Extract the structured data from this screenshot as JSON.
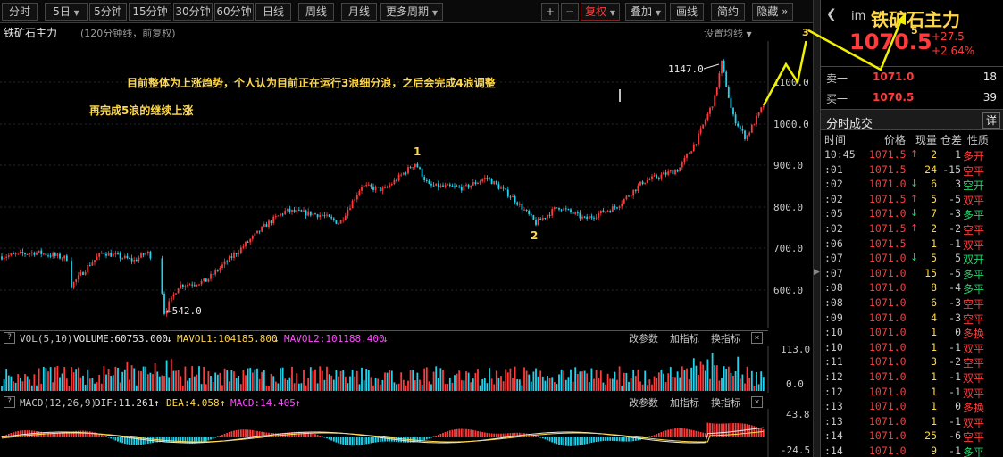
{
  "toolbar": {
    "left_buttons": [
      "分时",
      "5日",
      "5分钟",
      "15分钟",
      "30分钟",
      "60分钟",
      "日线",
      "周线",
      "月线",
      "更多周期"
    ],
    "right_buttons": [
      "+",
      "−",
      "复权",
      "叠加",
      "画线",
      "简约",
      "隐藏"
    ],
    "double_arrow": "»"
  },
  "chart": {
    "title": "铁矿石主力",
    "subtitle": "(120分钟线，前复权)",
    "ma_setting": "设置均线",
    "y_axis_labels": [
      "1100.0",
      "1000.0",
      "900.0",
      "800.0",
      "700.0",
      "600.0"
    ],
    "annotation_line1": "目前整体为上涨趋势，个人认为目前正在运行3浪细分浪，之后会完成4浪调整",
    "annotation_line2": "再完成5浪的继续上涨",
    "high_label": "1147.0",
    "low_label": "←542.0",
    "wave_labels": [
      "1",
      "2",
      "3",
      "5"
    ],
    "colors": {
      "up": "#ff3b3b",
      "down": "#22d3ee",
      "annotation": "#ffd84a",
      "wave_line": "#f0f000"
    }
  },
  "volume_panel": {
    "title": "VOL(5,10)",
    "volume": "VOLUME:60753.000",
    "mavol1": "MAVOL1:104185.800",
    "mavol2": "MAVOL2:101188.400",
    "y_labels": [
      "113.0",
      "0.0"
    ],
    "buttons": [
      "改参数",
      "加指标",
      "换指标"
    ]
  },
  "macd_panel": {
    "title": "MACD(12,26,9)",
    "dif": "DIF:11.261",
    "dea": "DEA:4.058",
    "macd": "MACD:14.405",
    "y_labels": [
      "43.8",
      "-24.5"
    ],
    "buttons": [
      "改参数",
      "加指标",
      "换指标"
    ]
  },
  "quote": {
    "back_icon": "chevron-left-icon",
    "code": "im",
    "name": "铁矿石主力",
    "price": "1070.5",
    "change": "+27.5",
    "change_pct": "+2.64%",
    "sell_label": "卖一",
    "sell_price": "1071.0",
    "sell_qty": "18",
    "buy_label": "买一",
    "buy_price": "1070.5",
    "buy_qty": "39"
  },
  "timesales": {
    "title": "分时成交",
    "detail_button": "详",
    "columns": [
      "时间",
      "价格",
      "现量",
      "仓差",
      "性质"
    ],
    "rows": [
      {
        "time": "10:45",
        "price": "1071.5",
        "arrow": "↑",
        "vol": "2",
        "oi": "1",
        "type": "多开"
      },
      {
        "time": ":01",
        "price": "1071.5",
        "arrow": "",
        "vol": "24",
        "oi": "-15",
        "type": "空平"
      },
      {
        "time": ":02",
        "price": "1071.0",
        "arrow": "↓",
        "vol": "6",
        "oi": "3",
        "type": "空开"
      },
      {
        "time": ":02",
        "price": "1071.5",
        "arrow": "↑",
        "vol": "5",
        "oi": "-5",
        "type": "双平"
      },
      {
        "time": ":05",
        "price": "1071.0",
        "arrow": "↓",
        "vol": "7",
        "oi": "-3",
        "type": "多平"
      },
      {
        "time": ":02",
        "price": "1071.5",
        "arrow": "↑",
        "vol": "2",
        "oi": "-2",
        "type": "空平"
      },
      {
        "time": ":06",
        "price": "1071.5",
        "arrow": "",
        "vol": "1",
        "oi": "-1",
        "type": "双平"
      },
      {
        "time": ":07",
        "price": "1071.0",
        "arrow": "↓",
        "vol": "5",
        "oi": "5",
        "type": "双开"
      },
      {
        "time": ":07",
        "price": "1071.0",
        "arrow": "",
        "vol": "15",
        "oi": "-5",
        "type": "多平"
      },
      {
        "time": ":08",
        "price": "1071.0",
        "arrow": "",
        "vol": "8",
        "oi": "-4",
        "type": "多平"
      },
      {
        "time": ":08",
        "price": "1071.0",
        "arrow": "",
        "vol": "6",
        "oi": "-3",
        "type": "空平"
      },
      {
        "time": ":09",
        "price": "1071.0",
        "arrow": "",
        "vol": "4",
        "oi": "-3",
        "type": "空平"
      },
      {
        "time": ":10",
        "price": "1071.0",
        "arrow": "",
        "vol": "1",
        "oi": "0",
        "type": "多换"
      },
      {
        "time": ":10",
        "price": "1071.0",
        "arrow": "",
        "vol": "1",
        "oi": "-1",
        "type": "双平"
      },
      {
        "time": ":11",
        "price": "1071.0",
        "arrow": "",
        "vol": "3",
        "oi": "-2",
        "type": "空平"
      },
      {
        "time": ":12",
        "price": "1071.0",
        "arrow": "",
        "vol": "1",
        "oi": "-1",
        "type": "双平"
      },
      {
        "time": ":12",
        "price": "1071.0",
        "arrow": "",
        "vol": "1",
        "oi": "-1",
        "type": "双平"
      },
      {
        "time": ":13",
        "price": "1071.0",
        "arrow": "",
        "vol": "1",
        "oi": "0",
        "type": "多换"
      },
      {
        "time": ":13",
        "price": "1071.0",
        "arrow": "",
        "vol": "1",
        "oi": "-1",
        "type": "双平"
      },
      {
        "time": ":14",
        "price": "1071.0",
        "arrow": "",
        "vol": "25",
        "oi": "-6",
        "type": "空平"
      },
      {
        "time": ":14",
        "price": "1071.0",
        "arrow": "",
        "vol": "9",
        "oi": "-1",
        "type": "多平"
      }
    ],
    "type_colors": {
      "多开": "#ff3b3b",
      "空平": "#ff3b3b",
      "空开": "#22d36b",
      "双平": "#ff3b3b",
      "多平": "#22d36b",
      "双开": "#22d36b",
      "多换": "#ff3b3b"
    }
  }
}
